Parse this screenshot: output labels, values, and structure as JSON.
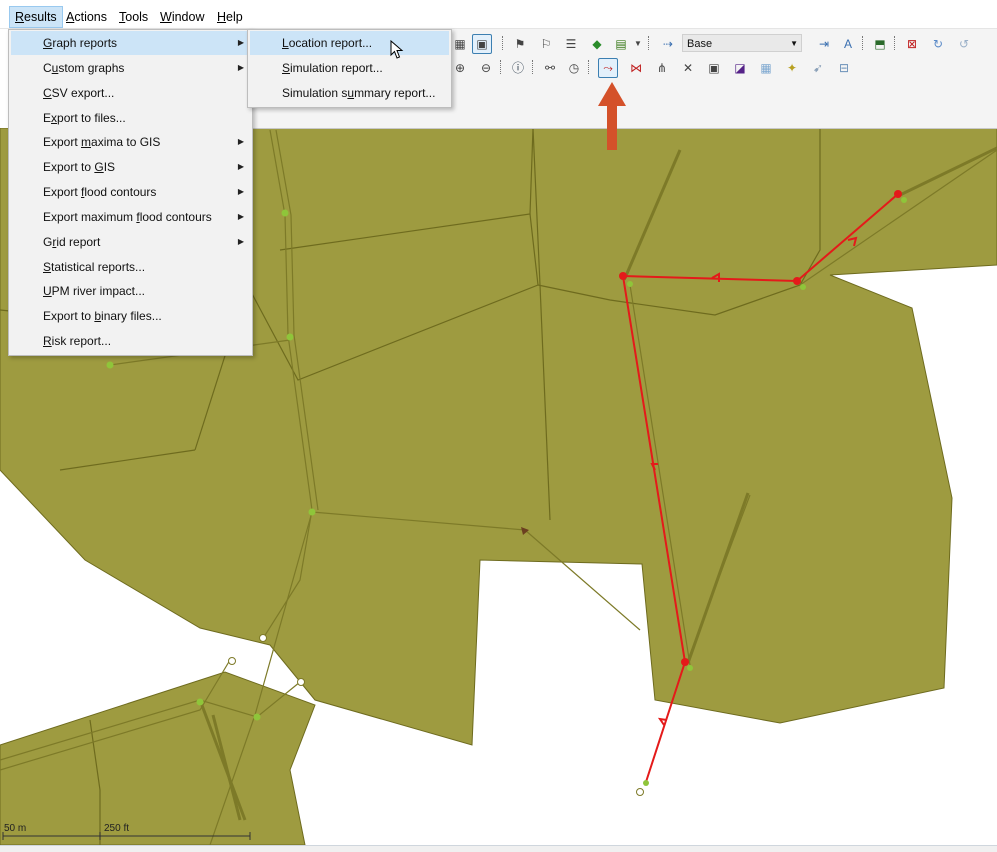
{
  "menubar": {
    "items": [
      {
        "label_pre": "",
        "mnemonic": "R",
        "label_post": "esults"
      },
      {
        "label_pre": "",
        "mnemonic": "A",
        "label_post": "ctions"
      },
      {
        "label_pre": "",
        "mnemonic": "T",
        "label_post": "ools"
      },
      {
        "label_pre": "",
        "mnemonic": "W",
        "label_post": "indow"
      },
      {
        "label_pre": "",
        "mnemonic": "H",
        "label_post": "elp"
      }
    ]
  },
  "results_menu": {
    "items": [
      {
        "label_pre": "",
        "mnemonic": "G",
        "label_post": "raph reports",
        "submenu": true
      },
      {
        "label_pre": "C",
        "mnemonic": "u",
        "label_post": "stom graphs",
        "submenu": true
      },
      {
        "label_pre": "",
        "mnemonic": "C",
        "label_post": "SV export...",
        "submenu": false
      },
      {
        "label_pre": "E",
        "mnemonic": "x",
        "label_post": "port to files...",
        "submenu": false
      },
      {
        "label_pre": "Export ",
        "mnemonic": "m",
        "label_post": "axima to GIS",
        "submenu": true
      },
      {
        "label_pre": "Export to ",
        "mnemonic": "G",
        "label_post": "IS",
        "submenu": true
      },
      {
        "label_pre": "Export ",
        "mnemonic": "f",
        "label_post": "lood contours",
        "submenu": true
      },
      {
        "label_pre": "Export maximum ",
        "mnemonic": "f",
        "label_post": "lood contours",
        "submenu": true
      },
      {
        "label_pre": "G",
        "mnemonic": "r",
        "label_post": "id report",
        "submenu": true
      },
      {
        "label_pre": "",
        "mnemonic": "S",
        "label_post": "tatistical reports...",
        "submenu": false
      },
      {
        "label_pre": "",
        "mnemonic": "U",
        "label_post": "PM river impact...",
        "submenu": false
      },
      {
        "label_pre": "Export to ",
        "mnemonic": "b",
        "label_post": "inary files...",
        "submenu": false
      },
      {
        "label_pre": "",
        "mnemonic": "R",
        "label_post": "isk report...",
        "submenu": false
      }
    ]
  },
  "graph_submenu": {
    "items": [
      {
        "label_pre": "",
        "mnemonic": "L",
        "label_post": "ocation report..."
      },
      {
        "label_pre": "",
        "mnemonic": "S",
        "label_post": "imulation report..."
      },
      {
        "label_pre": "Simulation s",
        "mnemonic": "u",
        "label_post": "mmary report..."
      }
    ]
  },
  "toolbar": {
    "scenario_value": "Base",
    "row1_icons": [
      "grid-icon",
      "view-icon",
      "flag-tool-icon",
      "flag-edit-icon",
      "stack-icon",
      "layers-icon",
      "table-icon",
      "route-icon",
      "text-style-icon",
      "map-export-icon",
      "delete-grid-icon",
      "refresh-icon",
      "refresh-alt-icon"
    ],
    "row2_icons": [
      "zoom-in-icon",
      "zoom-out-icon",
      "info-icon",
      "binoculars-icon",
      "clock-icon",
      "network-trace-icon",
      "network-split-icon",
      "network-merge-icon",
      "network-delete-icon",
      "map-box-icon",
      "map-box-alt-icon",
      "map-grid-icon",
      "wand-icon",
      "pointer-icon",
      "ruler-icon"
    ]
  },
  "map": {
    "scale_left": "50 m",
    "scale_right": "250 ft"
  },
  "colors": {
    "polygon_fill": "#9e9b40",
    "polygon_stroke": "#6e6b1e",
    "selection": "#e41a1a",
    "annotation_arrow": "#d4512a",
    "node_green": "#8fc53a"
  }
}
